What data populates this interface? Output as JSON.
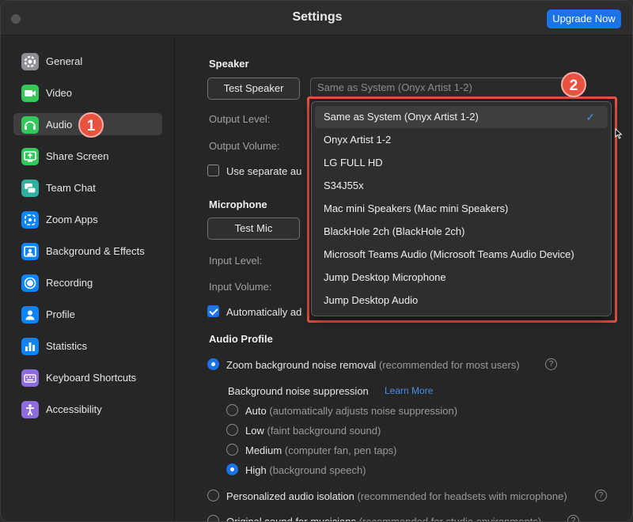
{
  "window": {
    "title": "Settings",
    "upgrade_label": "Upgrade Now"
  },
  "sidebar": {
    "items": [
      {
        "label": "General",
        "icon": "gear-icon",
        "color": "#8e8e93"
      },
      {
        "label": "Video",
        "icon": "video-icon",
        "color": "#34c759"
      },
      {
        "label": "Audio",
        "icon": "headphones-icon",
        "color": "#34c759",
        "active": true
      },
      {
        "label": "Share Screen",
        "icon": "share-screen-icon",
        "color": "#34c759"
      },
      {
        "label": "Team Chat",
        "icon": "chat-icon",
        "color": "#30b0a0"
      },
      {
        "label": "Zoom Apps",
        "icon": "apps-icon",
        "color": "#0a84ff"
      },
      {
        "label": "Background & Effects",
        "icon": "background-icon",
        "color": "#0a84ff"
      },
      {
        "label": "Recording",
        "icon": "recording-icon",
        "color": "#0a84ff"
      },
      {
        "label": "Profile",
        "icon": "profile-icon",
        "color": "#0a84ff"
      },
      {
        "label": "Statistics",
        "icon": "statistics-icon",
        "color": "#0a84ff"
      },
      {
        "label": "Keyboard Shortcuts",
        "icon": "keyboard-icon",
        "color": "#8e6cde"
      },
      {
        "label": "Accessibility",
        "icon": "accessibility-icon",
        "color": "#8e6cde"
      }
    ]
  },
  "badges": {
    "one": "1",
    "two": "2"
  },
  "speaker": {
    "title": "Speaker",
    "test_label": "Test Speaker",
    "selected_device": "Same as System (Onyx Artist 1-2)",
    "output_level_label": "Output Level:",
    "output_volume_label": "Output Volume:",
    "separate_label": "Use separate au"
  },
  "microphone": {
    "title": "Microphone",
    "test_label": "Test Mic",
    "input_level_label": "Input Level:",
    "input_volume_label": "Input Volume:",
    "auto_adjust_label": "Automatically ad"
  },
  "dropdown": {
    "items": [
      {
        "label": "Same as System (Onyx Artist 1-2)",
        "selected": true
      },
      {
        "label": "Onyx Artist 1-2"
      },
      {
        "label": "LG FULL HD"
      },
      {
        "label": "S34J55x"
      },
      {
        "label": "Mac mini Speakers (Mac mini Speakers)"
      },
      {
        "label": "BlackHole 2ch (BlackHole 2ch)"
      },
      {
        "label": "Microsoft Teams Audio (Microsoft Teams Audio Device)"
      },
      {
        "label": "Jump Desktop Microphone"
      },
      {
        "label": "Jump Desktop Audio"
      }
    ],
    "check_glyph": "✓"
  },
  "audio_profile": {
    "title": "Audio Profile",
    "zoom_noise_label": "Zoom background noise removal",
    "zoom_noise_hint": "(recommended for most users)",
    "suppression_label": "Background noise suppression",
    "learn_more": "Learn More",
    "levels": [
      {
        "label": "Auto",
        "hint": "(automatically adjusts noise suppression)"
      },
      {
        "label": "Low",
        "hint": "(faint background sound)"
      },
      {
        "label": "Medium",
        "hint": "(computer fan, pen taps)"
      },
      {
        "label": "High",
        "hint": "(background speech)",
        "selected": true
      }
    ],
    "isolation_label": "Personalized audio isolation",
    "isolation_hint": "(recommended for headsets with microphone)",
    "original_label": "Original sound for musicians",
    "original_hint": "(recommended for studio environments)",
    "help_glyph": "?"
  },
  "colors": {
    "accent": "#1a73e8",
    "annotation": "#e8523f"
  }
}
